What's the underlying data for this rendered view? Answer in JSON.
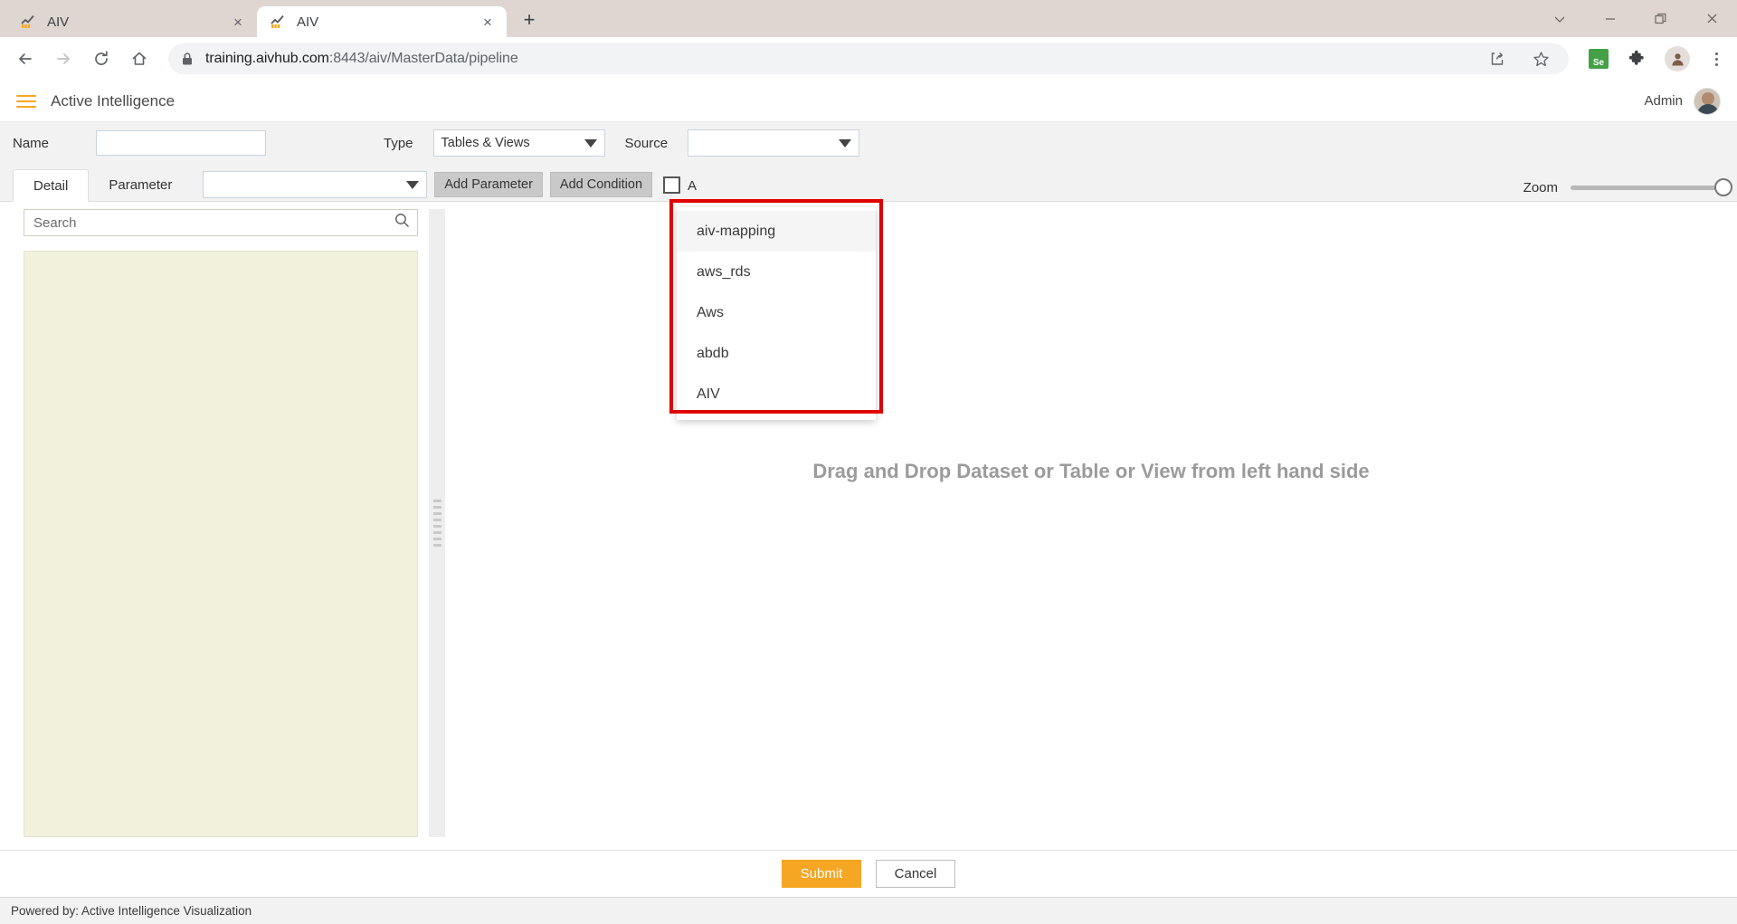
{
  "browser": {
    "tabs": [
      {
        "title": "AIV",
        "favicon": "aiv-chart-icon",
        "active": false,
        "close_label": "×"
      },
      {
        "title": "AIV",
        "favicon": "aiv-chart-icon",
        "active": true,
        "close_label": "×"
      }
    ],
    "new_tab_label": "+",
    "window_controls": {
      "minimize_group": "⌄",
      "minimize": "—",
      "maximize": "❐",
      "close": "✕"
    },
    "nav": {
      "back": "←",
      "forward": "→",
      "reload": "↻",
      "home": "⌂"
    },
    "url": "training.aivhub.com:8443/aiv/MasterData/pipeline",
    "url_host": "training.aivhub.com",
    "url_path": ":8443/aiv/MasterData/pipeline",
    "extension_badge": "Se"
  },
  "app": {
    "title": "Active Intelligence",
    "user": "Admin"
  },
  "filter": {
    "name_label": "Name",
    "name_value": "",
    "name_placeholder": "",
    "type_label": "Type",
    "type_value": "Tables & Views",
    "type_options": [
      "Tables & Views"
    ],
    "source_label": "Source",
    "source_value": ""
  },
  "tabs": {
    "detail_label": "Detail",
    "parameter_label": "Parameter",
    "param_select_value": "",
    "add_parameter_label": "Add Parameter",
    "add_condition_label": "Add Condition",
    "condition_checkbox_label": "A",
    "zoom_label": "Zoom",
    "zoom_value": 100
  },
  "left_panel": {
    "search_placeholder": "Search",
    "search_value": ""
  },
  "canvas": {
    "drop_hint": "Drag and Drop Dataset or Table or View from left hand side"
  },
  "source_dropdown": {
    "items": [
      {
        "label": "aiv-mapping",
        "highlighted": true
      },
      {
        "label": "aws_rds",
        "highlighted": false
      },
      {
        "label": "Aws",
        "highlighted": false
      },
      {
        "label": "abdb",
        "highlighted": false
      },
      {
        "label": "AIV",
        "highlighted": false
      }
    ],
    "highlight_color": "#e00000"
  },
  "actions": {
    "submit_label": "Submit",
    "cancel_label": "Cancel"
  },
  "footer": {
    "powered_by": "Powered by: Active Intelligence Visualization"
  }
}
